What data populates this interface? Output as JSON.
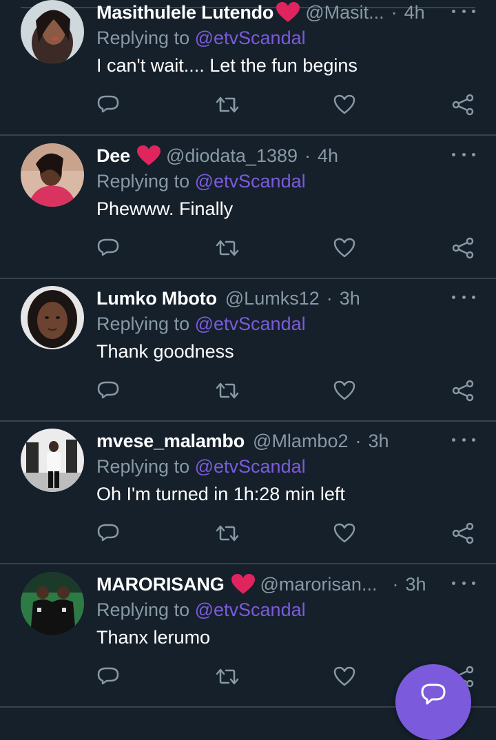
{
  "theme": {
    "background": "#15202b",
    "divider": "#38444d",
    "secondary_text": "#8899a6",
    "accent": "#7b5bdb",
    "heart": "#e0245e"
  },
  "tweets": [
    {
      "name": "Masithulele Lutendo",
      "badge": "heart-emoji",
      "handle": "@Masit...",
      "time": "4h",
      "replying_label": "Replying to",
      "mention": "@etvScandal",
      "text": "I can't wait.... Let the fun begins"
    },
    {
      "name": "Dee",
      "badge": "heart-emoji",
      "handle": "@diodata_1389",
      "time": "4h",
      "replying_label": "Replying to",
      "mention": "@etvScandal",
      "text": "Phewww. Finally"
    },
    {
      "name": "Lumko Mboto",
      "badge": "",
      "handle": "@Lumks12",
      "time": "3h",
      "replying_label": "Replying to",
      "mention": "@etvScandal",
      "text": "Thank goodness"
    },
    {
      "name": "mvese_malambo",
      "badge": "",
      "handle": "@Mlambo2",
      "time": "3h",
      "replying_label": "Replying to",
      "mention": "@etvScandal",
      "text": "Oh I'm turned in 1h:28 min left"
    },
    {
      "name": "MARORISANG",
      "badge": "heart-emoji",
      "handle": "@marorisan...",
      "time": "3h",
      "replying_label": "Replying to",
      "mention": "@etvScandal",
      "text": "Thanx lerumo"
    }
  ],
  "separator": "·",
  "actions": [
    "reply-icon",
    "retweet-icon",
    "like-icon",
    "share-icon"
  ],
  "fab": {
    "icon": "compose-reply-icon"
  }
}
